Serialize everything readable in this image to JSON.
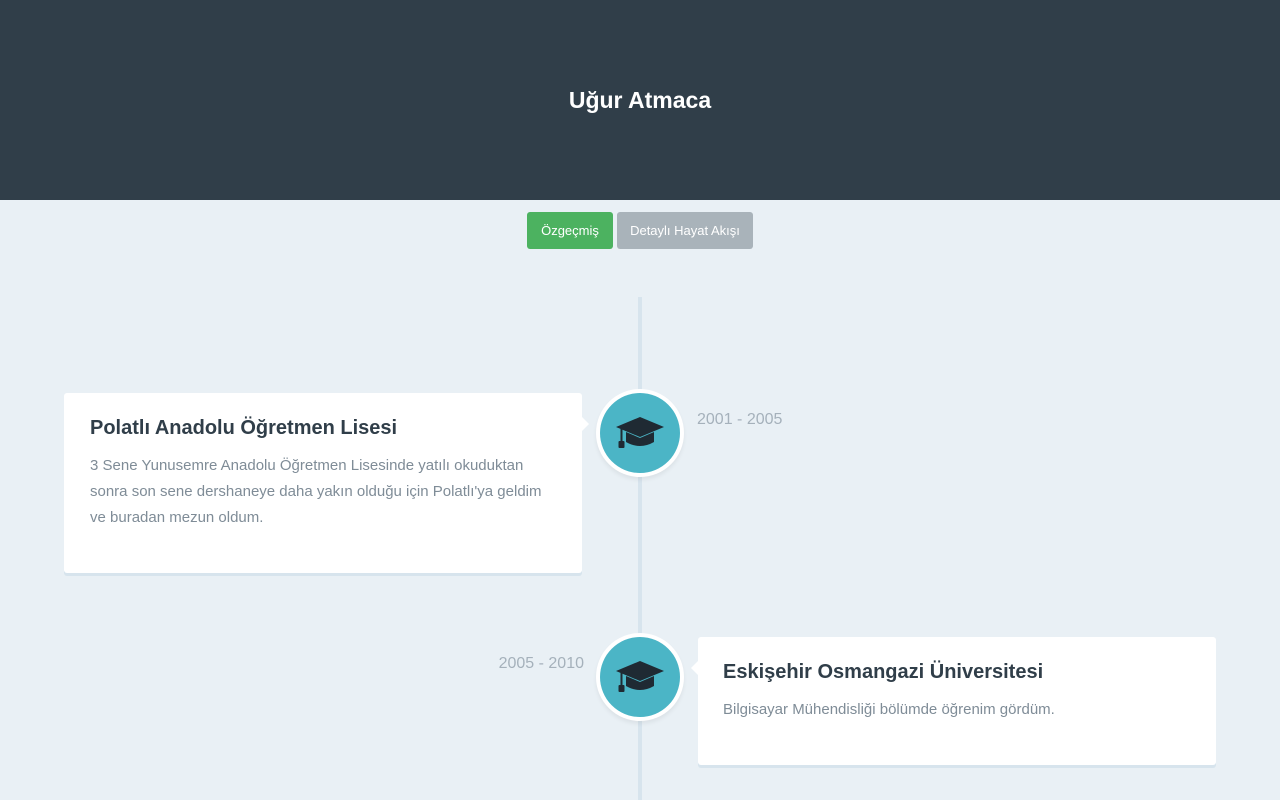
{
  "header": {
    "title": "Uğur Atmaca",
    "background_color": "#303e49"
  },
  "nav": {
    "cv_label": "Özgeçmiş",
    "detail_label": "Detaylı Hayat Akışı",
    "cv_color": "#4cb260",
    "detail_color": "#a9b3ba"
  },
  "timeline": {
    "items": [
      {
        "icon": "graduation-cap-icon",
        "date": "2001 - 2005",
        "title": "Polatlı Anadolu Öğretmen Lisesi",
        "description": "3 Sene Yunusemre Anadolu Öğretmen Lisesinde yatılı okuduktan sonra son sene dershaneye daha yakın olduğu için Polatlı'ya geldim ve buradan mezun oldum."
      },
      {
        "icon": "graduation-cap-icon",
        "date": "2005 - 2010",
        "title": "Eskişehir Osmangazi Üniversitesi",
        "description": "Bilgisayar Mühendisliği bölümde öğrenim gördüm."
      }
    ],
    "node_color": "#4bb5c6"
  }
}
